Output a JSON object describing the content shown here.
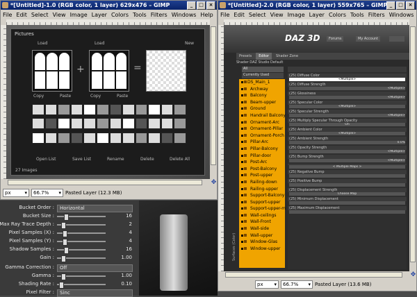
{
  "colors": {
    "title_active": "#0a246a",
    "daz_orange": "#f0a400",
    "window_bg": "#d4d0c8"
  },
  "left_window": {
    "title": "*[Untitled]-1.0 (RGB color, 1 layer) 629x476 – GIMP",
    "menus": [
      "File",
      "Edit",
      "Select",
      "View",
      "Image",
      "Layer",
      "Colors",
      "Tools",
      "Filters",
      "Windows",
      "Help"
    ],
    "pictures": {
      "title": "Pictures",
      "load_label_1": "Load",
      "load_label_2": "Load",
      "new_label": "New",
      "copy_label_1": "Copy",
      "paste_label_1": "Paste",
      "copy_label_2": "Copy",
      "paste_label_2": "Paste",
      "buttons": [
        "Open List",
        "Save List",
        "Rename",
        "Delete",
        "Delete All"
      ],
      "count": "27 Images"
    },
    "status": {
      "unit": "px",
      "zoom": "66.7%",
      "info": "Pasted Layer (12.3 MB)"
    }
  },
  "right_window": {
    "title": "*[Untitled]-2.0 (RGB color, 1 layer) 559x765 – GIMP",
    "menus": [
      "File",
      "Edit",
      "Select",
      "View",
      "Image",
      "Layer",
      "Colors",
      "Tools",
      "Filters",
      "Windows"
    ],
    "daz": {
      "logo": "DAZ 3D",
      "nav": [
        "Forums",
        "My Account",
        ""
      ],
      "tabs": [
        "Presets",
        "Editor",
        "Shader Zone"
      ],
      "shader_title": "Shader DAZ Studio Default",
      "list_tabs": [
        "All",
        "Currently Used"
      ],
      "root_item": "DS_Main_1",
      "items": [
        "Archway",
        "Balcony",
        "Beam-upper",
        "Ground",
        "Handrail Balcony",
        "Ornament-Arc",
        "Ornament-Pillar",
        "Ornament-Porch",
        "Pillar-Arc",
        "Pillar-Balcony",
        "Pillar-door",
        "Post-Arc",
        "Post-Balcony",
        "Post-upper",
        "Railing-down",
        "Railing-upper",
        "Support-Balcony",
        "Support-upper",
        "Support-upper-m",
        "Wall-ceilings",
        "Wall-Front",
        "Wall-side",
        "Wall-upper",
        "Window-Glas",
        "Window-upper"
      ],
      "side_label": "Surfaces (Color)",
      "props": [
        {
          "label": "(25) Diffuse Color",
          "control": "<Multiple>"
        },
        {
          "label": "(25) Diffuse Strength",
          "control": "<Multiple>"
        },
        {
          "label": "(25) Glossiness",
          "control": "<Multiple>"
        },
        {
          "label": "(25) Specular Color",
          "control": "<Multiple>"
        },
        {
          "label": "(25) Specular Strength",
          "control": "<Multiple>"
        },
        {
          "label": "(25) Multiply Specular Through Opacity",
          "control": "On"
        },
        {
          "label": "(25) Ambient Color",
          "control": "<Multiple>"
        },
        {
          "label": "(25) Ambient Strength",
          "control": "0.0%"
        },
        {
          "label": "(25) Opacity Strength",
          "control": "<Multiple>"
        },
        {
          "label": "(25) Bump Strength",
          "control": "<Multiple>"
        },
        {
          "label": "",
          "control": "< Multiple Maps >"
        },
        {
          "label": "(25) Negative Bump",
          "control": ""
        },
        {
          "label": "(25) Positive Bump",
          "control": ""
        },
        {
          "label": "(25) Displacement Strength",
          "control": "Choose Map"
        },
        {
          "label": "(25) Minimum Displacement",
          "control": ""
        },
        {
          "label": "(25) Maximum Displacement",
          "control": ""
        }
      ]
    },
    "status": {
      "unit": "px",
      "zoom": "66.7%",
      "info": "Pasted Layer (13.6 MB)"
    }
  },
  "render": {
    "rows": [
      {
        "label": "Bucket Order :",
        "type": "dropdown",
        "value": "Horizontal"
      },
      {
        "label": "Bucket Size :",
        "type": "slider",
        "value": "16",
        "pos": 0.15
      },
      {
        "label": "Max Ray Trace Depth :",
        "type": "slider",
        "value": "2",
        "pos": 0.1
      },
      {
        "label": "Pixel Samples (X) :",
        "type": "slider",
        "value": "4",
        "pos": 0.12
      },
      {
        "label": "Pixel Samples (Y) :",
        "type": "slider",
        "value": "4",
        "pos": 0.12
      },
      {
        "label": "Shadow Samples :",
        "type": "slider",
        "value": "16",
        "pos": 0.15
      },
      {
        "label": "Gain :",
        "type": "slider",
        "value": "1.00",
        "pos": 0.1
      },
      {
        "label": "Gamma Correction :",
        "type": "dropdown",
        "value": "Off"
      },
      {
        "label": "Gamma :",
        "type": "slider",
        "value": "1.00",
        "pos": 0.1
      },
      {
        "label": "Shading Rate :",
        "type": "slider",
        "value": "0.10",
        "pos": 0.05
      },
      {
        "label": "Pixel Filter :",
        "type": "dropdown",
        "value": "Sinc"
      }
    ]
  }
}
